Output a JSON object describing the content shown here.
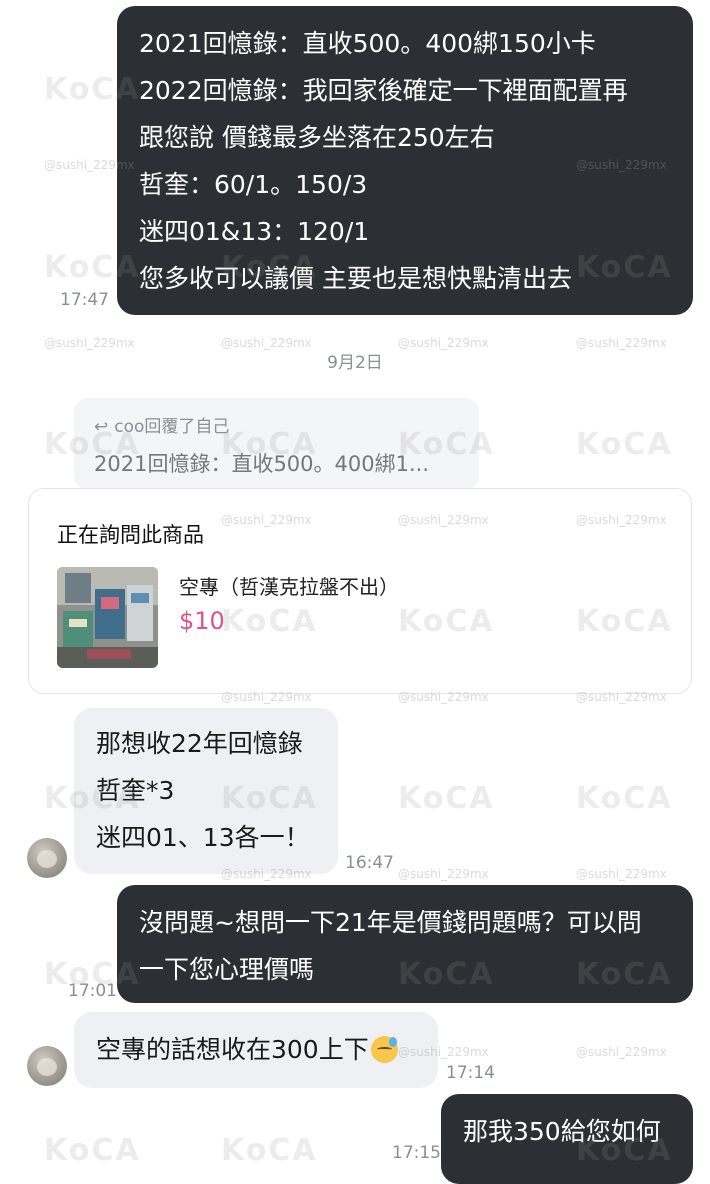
{
  "messages": {
    "m1": {
      "lines": [
        "2021回憶錄：直收500。400綁150小卡",
        "2022回憶錄：我回家後確定一下裡面配置再",
        "跟您說 價錢最多坐落在250左右",
        "哲奎：60/1。150/3",
        "迷四01&13：120/1",
        "您多收可以議價 主要也是想快點清出去"
      ],
      "time": "17:47"
    },
    "date_separator": "9月2日",
    "reply": {
      "header": "coo回覆了自己",
      "preview": "2021回憶錄：直收500。400綁1..."
    },
    "product": {
      "heading": "正在詢問此商品",
      "name": "空專（哲漢克拉盤不出）",
      "price": "$10"
    },
    "m2": {
      "lines": [
        "那想收22年回憶錄",
        "哲奎*3",
        "迷四01、13各一！"
      ],
      "time": "16:47"
    },
    "m3": {
      "lines": [
        "沒問題~想問一下21年是價錢問題嗎？可以問",
        "一下您心理價嗎"
      ],
      "time": "17:01"
    },
    "m4": {
      "text": "空專的話想收在300上下",
      "emoji": "sweat-smile-icon",
      "time": "17:14"
    },
    "m5": {
      "text": "那我350給您如何",
      "time": "17:15"
    }
  },
  "watermark": {
    "logo": "KoCA",
    "handle": "@sushi_229mx"
  },
  "colors": {
    "outgoing_bubble": "#2c3034",
    "incoming_bubble": "#eef0f3",
    "price": "#e0528a"
  }
}
